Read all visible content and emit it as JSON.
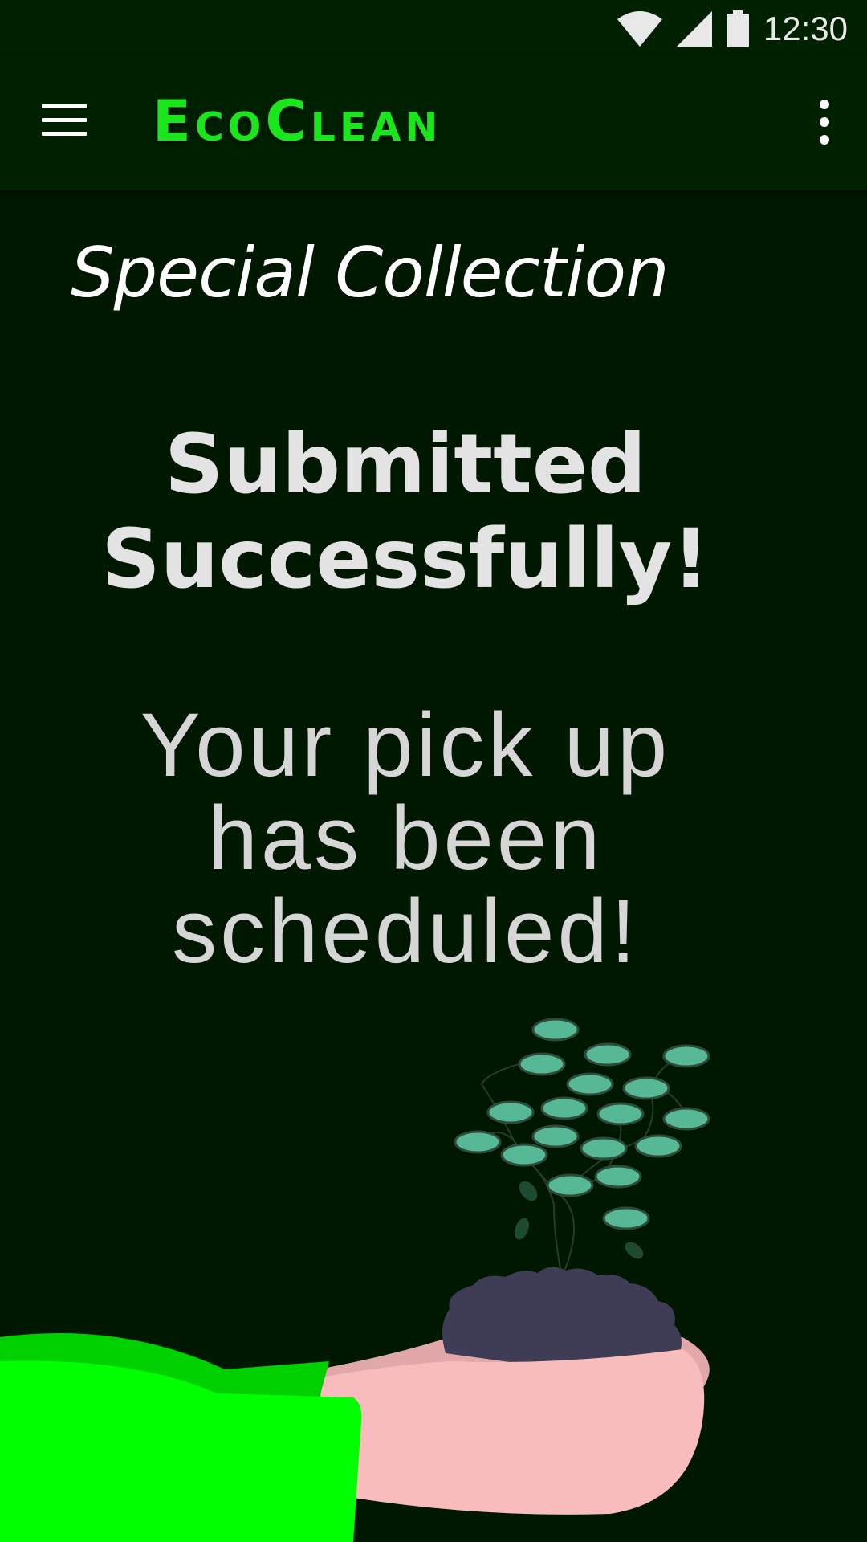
{
  "status_bar": {
    "time": "12:30",
    "icons": [
      "wifi-icon",
      "signal-icon",
      "battery-icon"
    ]
  },
  "app_bar": {
    "title": "EcoClean",
    "menu_icon": "hamburger-menu-icon",
    "overflow_icon": "more-vert-icon"
  },
  "page": {
    "section_title": "Special Collection",
    "headline_line1": "Submitted",
    "headline_line2": "Successfully!",
    "message_line1": "Your pick up",
    "message_line2": "has been",
    "message_line3": "scheduled!"
  },
  "colors": {
    "app_bar_bg": "#002100",
    "page_bg": "#001800",
    "accent_green": "#1be51b",
    "sleeve_green": "#00ff00",
    "leaf": "#56b894",
    "soil": "#3f3d56",
    "hand": "#f9bcbc"
  }
}
